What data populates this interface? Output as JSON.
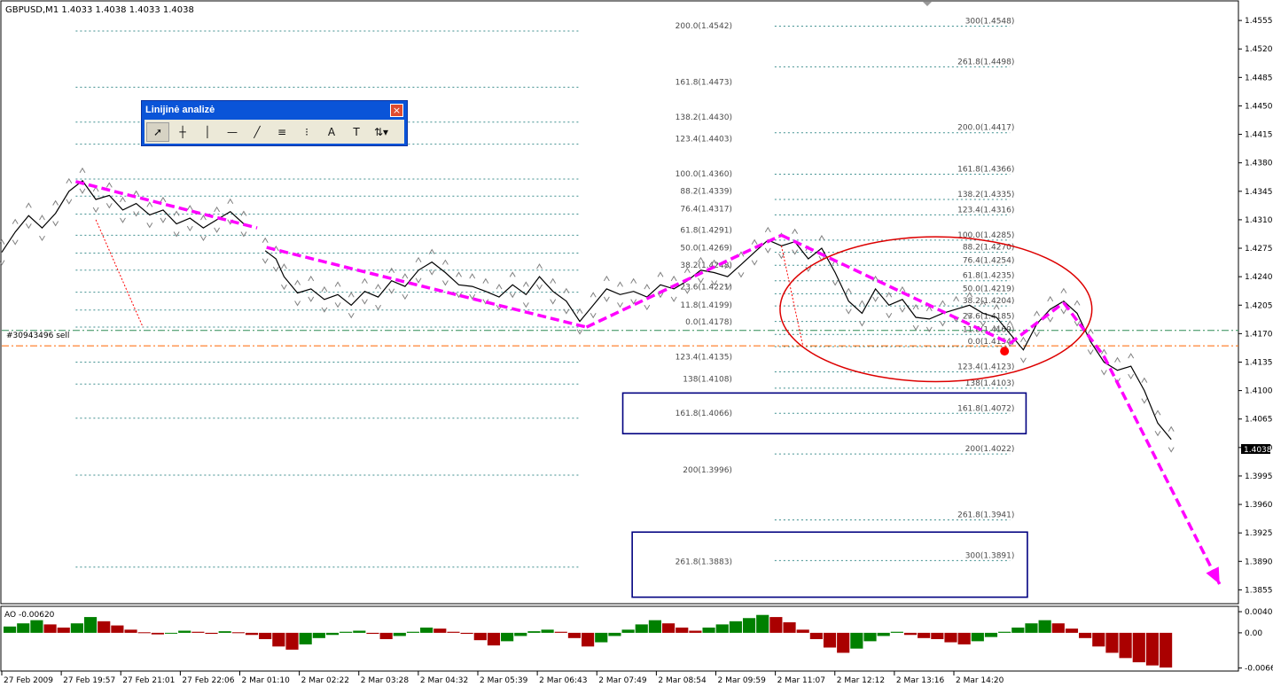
{
  "chart_header": "GBPUSD,M1  1.4033 1.4038 1.4033 1.4038",
  "order_label": "#30943496 sell",
  "current_price_label": "1.4038",
  "toolbar": {
    "title": "Linijinė analizė",
    "close_label": "×",
    "buttons": [
      {
        "name": "cursor-icon",
        "glyph": "➚"
      },
      {
        "name": "crosshair-icon",
        "glyph": "┼"
      },
      {
        "name": "vertical-line-icon",
        "glyph": "│"
      },
      {
        "name": "horizontal-line-icon",
        "glyph": "—"
      },
      {
        "name": "trendline-icon",
        "glyph": "╱"
      },
      {
        "name": "fib-expansion-icon",
        "glyph": "≡"
      },
      {
        "name": "fib-fan-icon",
        "glyph": "⁝"
      },
      {
        "name": "text-icon",
        "glyph": "A"
      },
      {
        "name": "text-label-icon",
        "glyph": "T"
      },
      {
        "name": "arrows-dropdown-icon",
        "glyph": "⇅▾"
      }
    ]
  },
  "colors": {
    "price": "#000000",
    "fractal": "#808080",
    "zigzag": "#ff00ff",
    "fib_line": "#3f8f8f",
    "order_line": "#2e8b57",
    "stop_line": "#ff6600",
    "ellipse": "#dd0000",
    "box": "#000080",
    "ao_up": "#008000",
    "ao_down": "#aa0000"
  },
  "chart_data": {
    "type": "line",
    "symbol": "GBPUSD",
    "timeframe": "M1",
    "ylim": [
      1.3838,
      1.4578
    ],
    "y_ticks": [
      "1.4555",
      "1.4520",
      "1.4485",
      "1.4450",
      "1.4415",
      "1.4380",
      "1.4345",
      "1.4310",
      "1.4275",
      "1.4240",
      "1.4205",
      "1.4170",
      "1.4135",
      "1.4100",
      "1.4065",
      "1.4030",
      "1.3995",
      "1.3960",
      "1.3925",
      "1.3890",
      "1.3855"
    ],
    "x_ticks": [
      "27 Feb 2009",
      "27 Feb 19:57",
      "27 Feb 21:01",
      "27 Feb 22:06",
      "2 Mar 01:10",
      "2 Mar 02:22",
      "2 Mar 03:28",
      "2 Mar 04:32",
      "2 Mar 05:39",
      "2 Mar 06:43",
      "2 Mar 07:49",
      "2 Mar 08:54",
      "2 Mar 09:59",
      "2 Mar 11:07",
      "2 Mar 12:12",
      "2 Mar 13:16",
      "2 Mar 14:20"
    ],
    "price_path": [
      [
        0,
        1.427
      ],
      [
        1,
        1.4295
      ],
      [
        2,
        1.4315
      ],
      [
        3,
        1.43
      ],
      [
        4,
        1.4318
      ],
      [
        5,
        1.4345
      ],
      [
        6,
        1.4358
      ],
      [
        7,
        1.4335
      ],
      [
        8,
        1.434
      ],
      [
        9,
        1.4322
      ],
      [
        10,
        1.433
      ],
      [
        11,
        1.4316
      ],
      [
        12,
        1.4322
      ],
      [
        13,
        1.4305
      ],
      [
        14,
        1.4312
      ],
      [
        15,
        1.43
      ],
      [
        16,
        1.431
      ],
      [
        17,
        1.432
      ],
      [
        18,
        1.4305
      ],
      [
        19.6,
        1.4272
      ],
      [
        20.4,
        1.4262
      ],
      [
        21,
        1.424
      ],
      [
        22,
        1.422
      ],
      [
        23,
        1.4225
      ],
      [
        24,
        1.4212
      ],
      [
        25,
        1.4218
      ],
      [
        26,
        1.4205
      ],
      [
        27,
        1.4222
      ],
      [
        28,
        1.4215
      ],
      [
        29,
        1.4235
      ],
      [
        30,
        1.4228
      ],
      [
        31,
        1.4248
      ],
      [
        32,
        1.4258
      ],
      [
        33,
        1.4245
      ],
      [
        34,
        1.423
      ],
      [
        35,
        1.4228
      ],
      [
        36,
        1.4222
      ],
      [
        37,
        1.4215
      ],
      [
        38,
        1.423
      ],
      [
        39,
        1.4218
      ],
      [
        40,
        1.424
      ],
      [
        41,
        1.4222
      ],
      [
        42,
        1.421
      ],
      [
        43,
        1.4185
      ],
      [
        44,
        1.4205
      ],
      [
        45,
        1.4225
      ],
      [
        46,
        1.4218
      ],
      [
        47,
        1.4222
      ],
      [
        48,
        1.4215
      ],
      [
        49,
        1.423
      ],
      [
        50,
        1.4225
      ],
      [
        51,
        1.4235
      ],
      [
        52,
        1.4248
      ],
      [
        53,
        1.4245
      ],
      [
        54,
        1.424
      ],
      [
        55,
        1.4255
      ],
      [
        56,
        1.427
      ],
      [
        57,
        1.4285
      ],
      [
        58,
        1.4278
      ],
      [
        59,
        1.4283
      ],
      [
        60,
        1.4262
      ],
      [
        61,
        1.4275
      ],
      [
        62,
        1.4245
      ],
      [
        63,
        1.421
      ],
      [
        64,
        1.4195
      ],
      [
        65,
        1.4225
      ],
      [
        66,
        1.4205
      ],
      [
        67,
        1.4212
      ],
      [
        68,
        1.419
      ],
      [
        69,
        1.4188
      ],
      [
        70,
        1.4195
      ],
      [
        71,
        1.42
      ],
      [
        72,
        1.4205
      ],
      [
        73,
        1.4195
      ],
      [
        74,
        1.419
      ],
      [
        75,
        1.417
      ],
      [
        76,
        1.415
      ],
      [
        77,
        1.4182
      ],
      [
        78,
        1.42
      ],
      [
        79,
        1.421
      ],
      [
        80,
        1.4195
      ],
      [
        81,
        1.416
      ],
      [
        82,
        1.4135
      ],
      [
        83,
        1.4125
      ],
      [
        84,
        1.413
      ],
      [
        85,
        1.41
      ],
      [
        86,
        1.406
      ],
      [
        87,
        1.404
      ]
    ],
    "zigzag_segments": [
      [
        [
          5.5,
          1.4357
        ],
        [
          19,
          1.43
        ]
      ],
      [
        [
          19.7,
          1.4276
        ],
        [
          43.5,
          1.4178
        ]
      ],
      [
        [
          43.5,
          1.4178
        ],
        [
          58,
          1.4291
        ]
      ],
      [
        [
          58,
          1.4291
        ],
        [
          75,
          1.4158
        ]
      ],
      [
        [
          75,
          1.4158
        ],
        [
          79,
          1.4208
        ]
      ],
      [
        [
          79,
          1.4208
        ],
        [
          82,
          1.4142
        ]
      ],
      [
        [
          82,
          1.4142
        ],
        [
          90.6,
          1.3862
        ]
      ]
    ],
    "sell_arrows": [
      [
        [
          7,
          1.431
        ],
        [
          10.5,
          1.4178
        ]
      ],
      [
        [
          58,
          1.4278
        ],
        [
          59.6,
          1.4155
        ]
      ]
    ],
    "order_price": 1.4174,
    "stop_price": 1.4155,
    "fib_sets": [
      {
        "x0": 5.5,
        "x1": 43,
        "label_x": 55,
        "levels": [
          {
            "label": "200.0(1.4542)",
            "price": 1.4542
          },
          {
            "label": "161.8(1.4473)",
            "price": 1.4473
          },
          {
            "label": "138.2(1.4430)",
            "price": 1.443
          },
          {
            "label": "123.4(1.4403)",
            "price": 1.4403
          },
          {
            "label": "100.0(1.4360)",
            "price": 1.436
          },
          {
            "label": "88.2(1.4339)",
            "price": 1.4339
          },
          {
            "label": "76.4(1.4317)",
            "price": 1.4317
          },
          {
            "label": "61.8(1.4291)",
            "price": 1.4291
          },
          {
            "label": "50.0(1.4269)",
            "price": 1.4269
          },
          {
            "label": "38.2(1.4248)",
            "price": 1.4248
          },
          {
            "label": "23.6(1.4221)",
            "price": 1.4221
          },
          {
            "label": "11.8(1.4199)",
            "price": 1.4199
          },
          {
            "label": "0.0(1.4178)",
            "price": 1.4178
          },
          {
            "label": "123.4(1.4135)",
            "price": 1.4135
          },
          {
            "label": "138(1.4108)",
            "price": 1.4108
          },
          {
            "label": "161.8(1.4066)",
            "price": 1.4066
          },
          {
            "label": "200(1.3996)",
            "price": 1.3996
          },
          {
            "label": "261.8(1.3883)",
            "price": 1.3883
          }
        ]
      },
      {
        "x0": 57.5,
        "x1": 75,
        "label_x": 76,
        "levels": [
          {
            "label": "300(1.4548)",
            "price": 1.4548
          },
          {
            "label": "261.8(1.4498)",
            "price": 1.4498
          },
          {
            "label": "200.0(1.4417)",
            "price": 1.4417
          },
          {
            "label": "161.8(1.4366)",
            "price": 1.4366
          },
          {
            "label": "138.2(1.4335)",
            "price": 1.4335
          },
          {
            "label": "123.4(1.4316)",
            "price": 1.4316
          },
          {
            "label": "100.0(1.4285)",
            "price": 1.4285
          },
          {
            "label": "88.2(1.4270)",
            "price": 1.427
          },
          {
            "label": "76.4(1.4254)",
            "price": 1.4254
          },
          {
            "label": "61.8(1.4235)",
            "price": 1.4235
          },
          {
            "label": "50.0(1.4219)",
            "price": 1.4219
          },
          {
            "label": "38.2(1.4204)",
            "price": 1.4204
          },
          {
            "label": "23.6(1.4185)",
            "price": 1.4185
          },
          {
            "label": "11.8(1.4169)",
            "price": 1.4169
          },
          {
            "label": "0.0(1.4154)",
            "price": 1.4154
          },
          {
            "label": "123.4(1.4123)",
            "price": 1.4123
          },
          {
            "label": "138(1.4103)",
            "price": 1.4103
          },
          {
            "label": "161.8(1.4072)",
            "price": 1.4072
          },
          {
            "label": "200(1.4022)",
            "price": 1.4022
          },
          {
            "label": "261.8(1.3941)",
            "price": 1.3941
          },
          {
            "label": "300(1.3891)",
            "price": 1.3891
          }
        ]
      }
    ],
    "target_boxes": [
      {
        "x0": 46.2,
        "x1": 76.2,
        "y0": 1.4097,
        "y1": 1.4047
      },
      {
        "x0": 46.9,
        "x1": 76.3,
        "y0": 1.3926,
        "y1": 1.3846
      }
    ],
    "ellipse": {
      "cx": 69.5,
      "cy": 1.42,
      "rx": 11.6,
      "ry": 0.0089
    },
    "ao": {
      "label": "AO -0.00620",
      "ylim": [
        -0.0071,
        0.0047
      ],
      "y_ticks": [
        "0.00402",
        "0.00",
        "-0.00669"
      ],
      "values": [
        0.0012,
        0.0018,
        0.0024,
        0.0016,
        0.001,
        0.0018,
        0.003,
        0.0022,
        0.0014,
        0.0006,
        0.0001,
        -0.0003,
        -0.0001,
        0.0004,
        0.0002,
        -0.0002,
        0.0003,
        0.0001,
        -0.0004,
        -0.0012,
        -0.0026,
        -0.0032,
        -0.0022,
        -0.001,
        -0.0004,
        0.0002,
        0.0004,
        -0.0002,
        -0.0012,
        -0.0006,
        0.0002,
        0.001,
        0.0008,
        0.0002,
        -0.0002,
        -0.0014,
        -0.0024,
        -0.0016,
        -0.0006,
        0.0003,
        0.0006,
        0.0002,
        -0.001,
        -0.0026,
        -0.0018,
        -0.0006,
        0.0006,
        0.0016,
        0.0024,
        0.0018,
        0.001,
        0.0004,
        0.001,
        0.0016,
        0.0022,
        0.0028,
        0.0034,
        0.003,
        0.002,
        0.0006,
        -0.0012,
        -0.0028,
        -0.0038,
        -0.003,
        -0.0016,
        -0.0006,
        0.0002,
        -0.0004,
        -0.001,
        -0.0012,
        -0.0018,
        -0.0022,
        -0.0016,
        -0.0008,
        0.0002,
        0.001,
        0.0018,
        0.0024,
        0.0018,
        0.0008,
        -0.001,
        -0.0026,
        -0.0038,
        -0.0048,
        -0.0056,
        -0.0062,
        -0.0066
      ]
    }
  }
}
